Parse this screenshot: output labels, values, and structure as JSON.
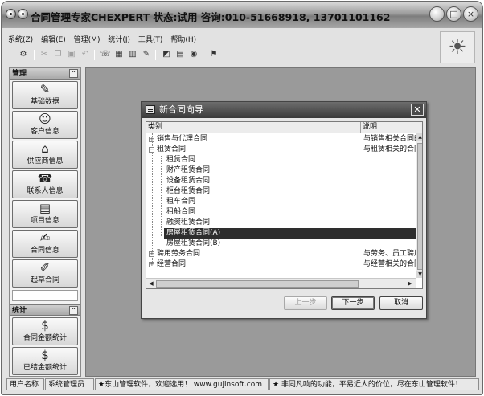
{
  "window": {
    "title": "合同管理专家CHEXPERT 状态:试用 咨询:010-51668918, 13701101162",
    "controls": {
      "minimize": "−",
      "maximize": "□",
      "close": "×"
    }
  },
  "menu": [
    "系统(Z)",
    "编辑(E)",
    "管理(M)",
    "统计(J)",
    "工具(T)",
    "帮助(H)"
  ],
  "left_panel": {
    "manage_header": "管理",
    "manage_items": [
      {
        "label": "基础数据",
        "icon": "✎"
      },
      {
        "label": "客户信息",
        "icon": "☺"
      },
      {
        "label": "供应商信息",
        "icon": "⌂"
      },
      {
        "label": "联系人信息",
        "icon": "☎"
      },
      {
        "label": "项目信息",
        "icon": "▤"
      },
      {
        "label": "合同信息",
        "icon": "✍"
      },
      {
        "label": "起草合同",
        "icon": "✐"
      }
    ],
    "stats_header": "统计",
    "stats_items": [
      {
        "label": "合同金额统计",
        "icon": "$"
      },
      {
        "label": "已结金额统计",
        "icon": "$"
      }
    ],
    "collapse_icon": "⌃"
  },
  "dialog": {
    "title": "新合同向导",
    "columns": [
      "类别",
      "说明"
    ],
    "rows": [
      {
        "level": 0,
        "expander": "+",
        "name": "销售与代理合同",
        "desc": "与销售相关合同的",
        "selected": false
      },
      {
        "level": 0,
        "expander": "−",
        "name": "租赁合同",
        "desc": "与租赁相关的合同",
        "selected": false
      },
      {
        "level": 1,
        "expander": "",
        "name": "租赁合同",
        "desc": "",
        "selected": false
      },
      {
        "level": 1,
        "expander": "",
        "name": "财产租赁合同",
        "desc": "",
        "selected": false
      },
      {
        "level": 1,
        "expander": "",
        "name": "设备租赁合同",
        "desc": "",
        "selected": false
      },
      {
        "level": 1,
        "expander": "",
        "name": "柜台租赁合同",
        "desc": "",
        "selected": false
      },
      {
        "level": 1,
        "expander": "",
        "name": "租车合同",
        "desc": "",
        "selected": false
      },
      {
        "level": 1,
        "expander": "",
        "name": "租船合同",
        "desc": "",
        "selected": false
      },
      {
        "level": 1,
        "expander": "",
        "name": "融资租赁合同",
        "desc": "",
        "selected": false
      },
      {
        "level": 1,
        "expander": "",
        "name": "房屋租赁合同(A)",
        "desc": "",
        "selected": true
      },
      {
        "level": 1,
        "expander": "",
        "name": "房屋租赁合同(B)",
        "desc": "",
        "selected": false
      },
      {
        "level": 0,
        "expander": "+",
        "name": "聘用劳务合同",
        "desc": "与劳务、员工聘用",
        "selected": false
      },
      {
        "level": 0,
        "expander": "+",
        "name": "经营合同",
        "desc": "与经营相关的合同",
        "selected": false
      }
    ],
    "buttons": {
      "prev": "上一步",
      "next": "下一步",
      "cancel": "取消"
    }
  },
  "status_bar": {
    "user_label": "用户名称",
    "user_value": "系统管理员",
    "welcome": "★东山管理软件，欢迎选用！ www.gujinsoft.com",
    "slogan": "★ 非同凡响的功能，平易近人的价位，尽在东山管理软件！"
  },
  "colors": {
    "selection": "#2e2e2e",
    "workspace": "#9a9a9a",
    "dialog_title": "#3a3a3a"
  }
}
